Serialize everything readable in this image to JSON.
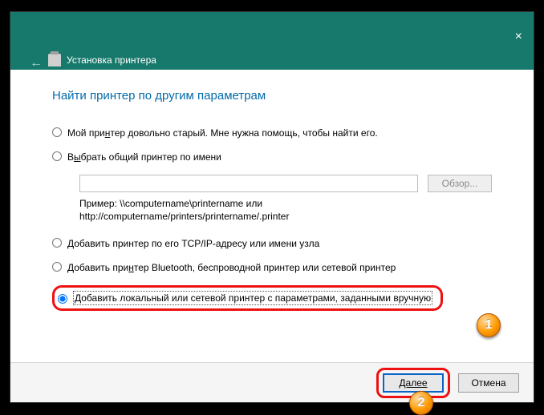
{
  "window": {
    "close": "×",
    "back": "←",
    "title": "Установка принтера"
  },
  "heading": "Найти принтер по другим параметрам",
  "options": {
    "old_pre": "Мой при",
    "old_u": "н",
    "old_post": "тер довольно старый. Мне нужна помощь, чтобы найти его.",
    "shared_pre": "В",
    "shared_u": "ы",
    "shared_post": "брать общий принтер по имени",
    "tcp": "Добавить принтер по его TCP/IP-адресу или имени узла",
    "bt_pre": "Добавить при",
    "bt_u": "н",
    "bt_post": "тер Bluetooth, беспроводной принтер или сетевой принтер",
    "local": "Добавить локальный или сетевой принтер с параметрами, заданными вручную"
  },
  "browse": "Обзор...",
  "example_l1": "Пример: \\\\computername\\printername или",
  "example_l2": "http://computername/printers/printername/.printer",
  "footer": {
    "next": "Далее",
    "cancel": "Отмена"
  },
  "markers": {
    "one": "1",
    "two": "2"
  }
}
